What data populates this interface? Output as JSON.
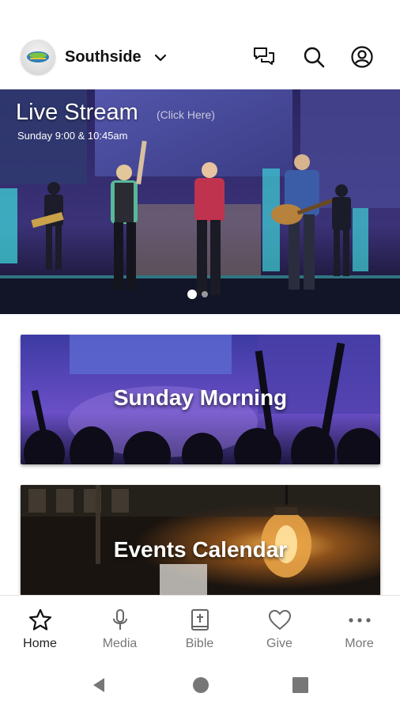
{
  "header": {
    "org_name": "Southside"
  },
  "hero": {
    "title": "Live Stream",
    "click_hint": "(Click Here)",
    "subtitle": "Sunday 9:00 & 10:45am"
  },
  "cards": [
    {
      "title": "Sunday Morning"
    },
    {
      "title": "Events Calendar"
    }
  ],
  "tabs": [
    {
      "label": "Home",
      "icon": "star-icon",
      "active": true
    },
    {
      "label": "Media",
      "icon": "microphone-icon",
      "active": false
    },
    {
      "label": "Bible",
      "icon": "bible-icon",
      "active": false
    },
    {
      "label": "Give",
      "icon": "heart-icon",
      "active": false
    },
    {
      "label": "More",
      "icon": "more-dots-icon",
      "active": false
    }
  ],
  "colors": {
    "tab_active": "#222222",
    "tab_inactive": "#777777",
    "hero_stage": "#3a2f6e"
  }
}
